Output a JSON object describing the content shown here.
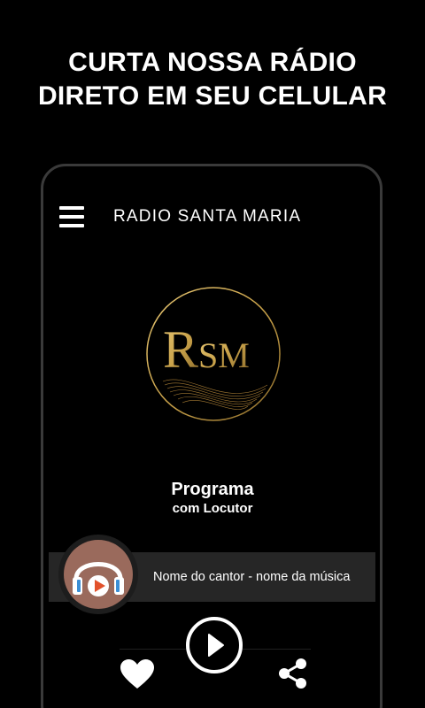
{
  "promo": {
    "line1": "CURTA NOSSA RÁDIO",
    "line2": "DIRETO EM SEU CELULAR"
  },
  "app": {
    "title": "RADIO SANTA MARIA",
    "menu_icon": "hamburger-menu-icon"
  },
  "logo": {
    "text_r": "R",
    "text_sm": "SM",
    "gold": "#c9a24a"
  },
  "program": {
    "name": "Programa",
    "host": "com Locutor"
  },
  "player": {
    "track": "Nome do cantor - nome da música",
    "badge_icon": "headphones-icon",
    "play_icon": "play-icon",
    "like_icon": "heart-icon",
    "share_icon": "share-icon"
  },
  "colors": {
    "background": "#000000",
    "bar": "#262626",
    "badge": "#9a6a5c",
    "headphone_blue": "#3b8fd6",
    "play_orange": "#e2512b"
  }
}
